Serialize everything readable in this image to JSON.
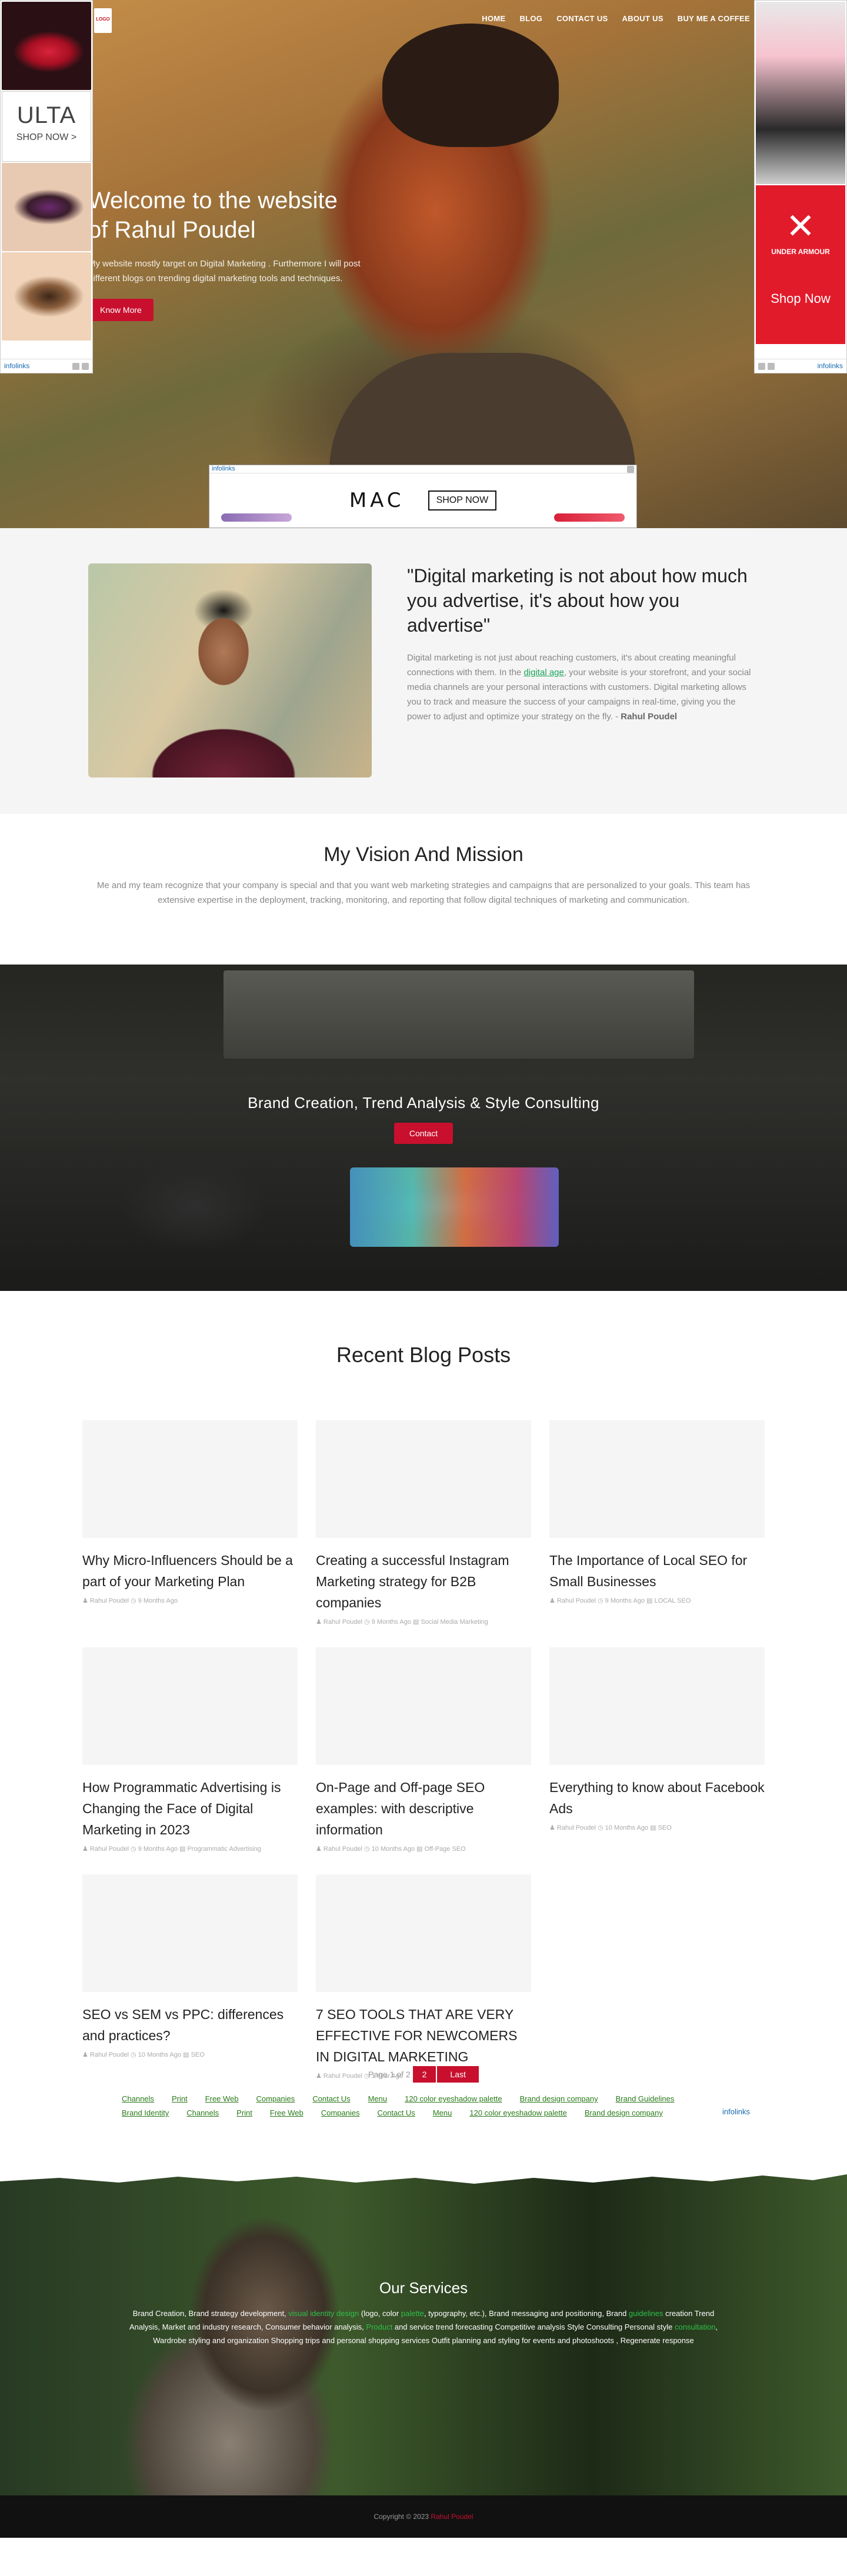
{
  "nav": {
    "logo": "LOGO",
    "items": [
      "HOME",
      "BLOG",
      "CONTACT US",
      "ABOUT US",
      "BUY ME A COFFEE"
    ]
  },
  "hero": {
    "title_line1": "Welcome to the website",
    "title_line2": "of Rahul Poudel",
    "text": "My website mostly target on Digital Marketing . Furthermore I will post different blogs on trending digital marketing tools and techniques.",
    "button": "Know More"
  },
  "ads": {
    "left": {
      "brand": "ULTA",
      "shop": "SHOP NOW >",
      "label": "infolinks"
    },
    "right": {
      "brand": "UNDER ARMOUR",
      "shop": "Shop Now",
      "label": "infolinks"
    },
    "bottom": {
      "label": "infolinks",
      "brand": "MAC",
      "shop": "SHOP NOW"
    }
  },
  "quote": {
    "heading": "\"Digital marketing is not about how much you advertise, it's about how you advertise\"",
    "text_before": "Digital marketing is not just about reaching customers, it's about creating meaningful connections with them. In the ",
    "link": "digital age",
    "text_after": ", your website is your storefront, and your social media channels are your personal interactions with customers. Digital marketing allows you to track and measure the success of your campaigns in real-time, giving you the power to adjust and optimize your strategy on the fly. -",
    "author": "Rahul Poudel"
  },
  "vision": {
    "title": "My Vision And Mission",
    "text": "Me and my team recognize that your company is special and that you want web marketing strategies and campaigns that are personalized to your goals. This team has extensive expertise in the deployment, tracking, monitoring, and reporting that follow digital techniques of marketing and communication."
  },
  "brand": {
    "title": "Brand Creation, Trend Analysis & Style Consulting",
    "button": "Contact"
  },
  "blog": {
    "title": "Recent Blog Posts",
    "posts": [
      {
        "title": "Why Micro-Influencers Should be a part of your Marketing Plan",
        "meta": "♟ Rahul Poudel  ◷ 9 Months Ago"
      },
      {
        "title": "Creating a successful Instagram Marketing strategy for B2B companies",
        "meta": "♟ Rahul Poudel  ◷ 9 Months Ago  ▤ Social Media Marketing"
      },
      {
        "title": "The Importance of Local SEO for Small Businesses",
        "meta": "♟ Rahul Poudel  ◷ 9 Months Ago  ▤ LOCAL SEO"
      },
      {
        "title": "How Programmatic Advertising is Changing the Face of Digital Marketing in 2023",
        "meta": "♟ Rahul Poudel  ◷ 9 Months Ago  ▤ Programmatic Advertising"
      },
      {
        "title": "On-Page and Off-page SEO examples: with descriptive information",
        "meta": "♟ Rahul Poudel  ◷ 10 Months Ago  ▤ Off-Page SEO"
      },
      {
        "title": "Everything to know about Facebook Ads",
        "meta": "♟ Rahul Poudel  ◷ 10 Months Ago  ▤ SEO"
      },
      {
        "title": "SEO vs SEM vs PPC: differences and practices?",
        "meta": "♟ Rahul Poudel  ◷ 10 Months Ago  ▤ SEO"
      },
      {
        "title": "7 SEO TOOLS THAT ARE VERY EFFECTIVE FOR NEWCOMERS IN DIGITAL MARKETING",
        "meta": "♟ Rahul Poudel  ◷ 1 Year Ago"
      }
    ],
    "pager": {
      "label": "Page 1 of 2",
      "current": "2",
      "last": "Last"
    }
  },
  "link_ads": {
    "row1": [
      "Channels",
      "Print",
      "Free Web",
      "Companies",
      "Contact Us",
      "Menu",
      "120 color eyeshadow palette",
      "Brand design company",
      "Brand Guidelines"
    ],
    "row2": [
      "Brand Identity",
      "Channels",
      "Print",
      "Free Web",
      "Companies",
      "Contact Us",
      "Menu",
      "120 color eyeshadow palette",
      "Brand design company"
    ],
    "label": "infolinks"
  },
  "services": {
    "title": "Our Services",
    "p1": "Brand Creation, Brand strategy development, ",
    "g1": "visual identity design",
    "p2": " (logo, color ",
    "g2": "palette",
    "p3": ", typography, etc.), Brand messaging and positioning, Brand ",
    "g3": "guidelines",
    "p4": " creation Trend Analysis, Market and industry research, Consumer behavior analysis, ",
    "g4": "Product",
    "p5": " and service trend forecasting Competitive analysis Style Consulting Personal style ",
    "g5": "consultation",
    "p6": ", Wardrobe styling and organization Shopping trips and personal shopping services Outfit planning and styling for events and photoshoots , Regenerate response"
  },
  "footer": {
    "text": "Copyright © 2023 ",
    "name": "Rahul Poudel"
  },
  "colors": {
    "accent": "#c8102e",
    "link_green": "#19a35a"
  }
}
